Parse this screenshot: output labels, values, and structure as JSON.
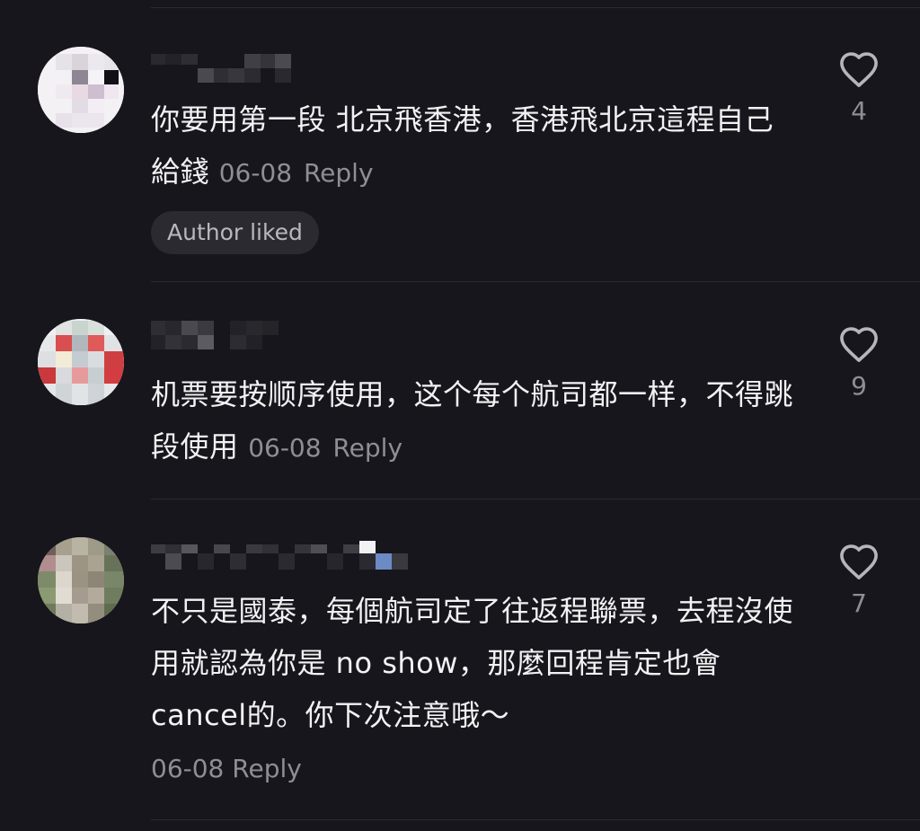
{
  "comments": [
    {
      "text": "你要用第一段 北京飛香港，香港飛北京這程自己給錢",
      "date": "06-08",
      "reply": "Reply",
      "badge": "Author liked",
      "likes": "4"
    },
    {
      "text": "机票要按顺序使用，这个每个航司都一样，不得跳段使用",
      "date": "06-08",
      "reply": "Reply",
      "likes": "9"
    },
    {
      "text": "不只是國泰，每個航司定了往返程聯票，去程沒使用就認為你是 no show，那麼回程肯定也會 cancel的。你下次注意哦～",
      "date": "06-08",
      "reply": "Reply",
      "likes": "7"
    }
  ],
  "colors": {
    "background": "#17161c",
    "text": "#f2f2f4",
    "muted": "#8f8e95",
    "badge_bg": "#2b2a31"
  },
  "icons": {
    "like": "heart-outline-icon"
  }
}
